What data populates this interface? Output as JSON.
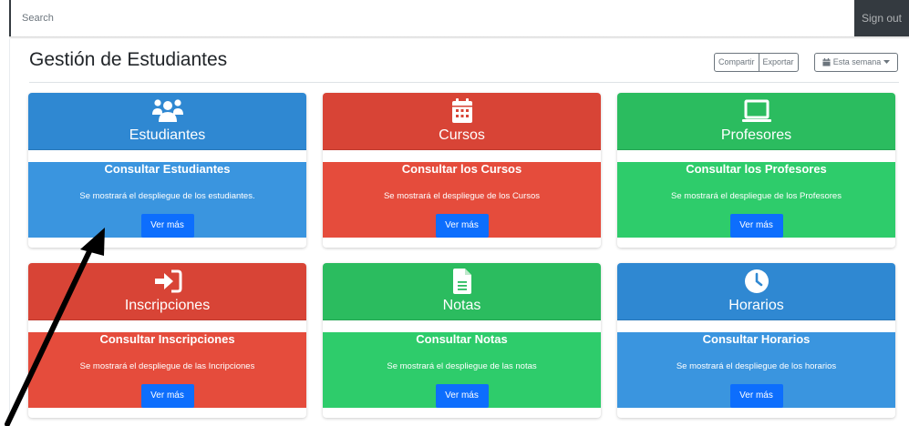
{
  "navbar": {
    "search_placeholder": "Search",
    "signout_label": "Sign out"
  },
  "header": {
    "title": "Gestión de Estudiantes",
    "share_label": "Compartir",
    "export_label": "Exportar",
    "week_label": "Esta semana"
  },
  "cards": [
    {
      "category": "Estudiantes",
      "title": "Consultar Estudiantes",
      "text": "Se mostrará el despliegue de los estudiantes.",
      "button": "Ver más",
      "icon": "users-icon",
      "color": "blue"
    },
    {
      "category": "Cursos",
      "title": "Consultar los Cursos",
      "text": "Se mostrará el despliegue de los Cursos",
      "button": "Ver más",
      "icon": "calendar-icon",
      "color": "red"
    },
    {
      "category": "Profesores",
      "title": "Consultar los Profesores",
      "text": "Se mostrará el despliegue de los Profesores",
      "button": "Ver más",
      "icon": "laptop-icon",
      "color": "green"
    },
    {
      "category": "Inscripciones",
      "title": "Consultar Inscripciones",
      "text": "Se mostrará el despliegue de las Incripciones",
      "button": "Ver más",
      "icon": "sign-in-icon",
      "color": "red"
    },
    {
      "category": "Notas",
      "title": "Consultar Notas",
      "text": "Se mostrará el despliegue de las notas",
      "button": "Ver más",
      "icon": "file-icon",
      "color": "green"
    },
    {
      "category": "Horarios",
      "title": "Consultar Horarios",
      "text": "Se mostrará el despliegue de los horarios",
      "button": "Ver más",
      "icon": "clock-icon",
      "color": "blue"
    }
  ],
  "colors": {
    "blue": "#3a95df",
    "red": "#e54c3c",
    "green": "#2ecc6b",
    "button": "#0d6efd",
    "navbar_dark": "#343a40"
  }
}
